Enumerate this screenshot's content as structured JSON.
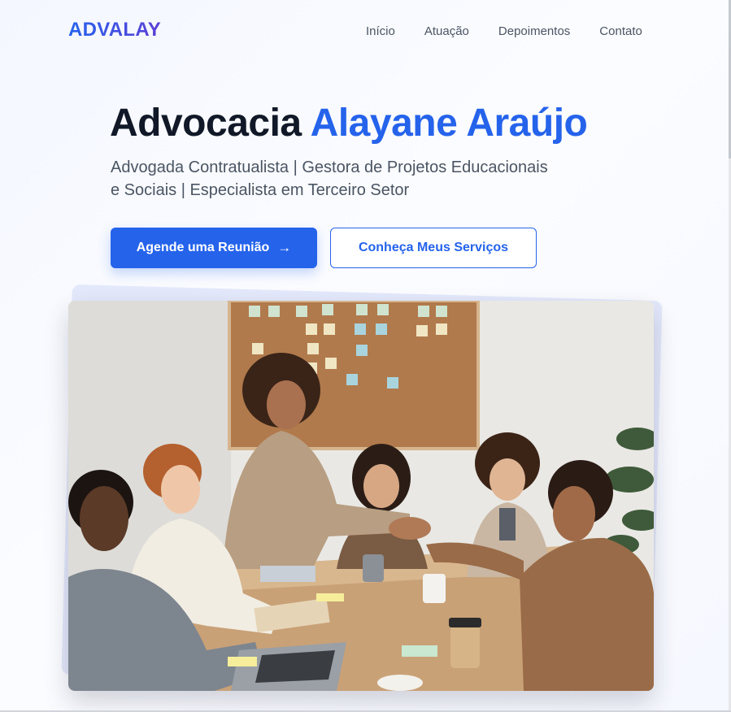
{
  "brand": {
    "logo": "ADVALAY"
  },
  "nav": {
    "items": [
      {
        "label": "Início"
      },
      {
        "label": "Atuação"
      },
      {
        "label": "Depoimentos"
      },
      {
        "label": "Contato"
      }
    ]
  },
  "hero": {
    "title_part1": "Advocacia ",
    "title_accent": "Alayane Araújo",
    "subtitle_line1": "Advogada Contratualista | Gestora de Projetos Educacionais",
    "subtitle_line2": "e Sociais | Especialista em Terceiro Setor",
    "cta_primary": "Agende uma Reunião",
    "cta_primary_icon": "arrow-right-icon",
    "cta_secondary": "Conheça Meus Serviços"
  },
  "colors": {
    "accent": "#2563eb",
    "accent_purple": "#5b3fd6",
    "text_dark": "#111827",
    "text_muted": "#4b5563"
  }
}
